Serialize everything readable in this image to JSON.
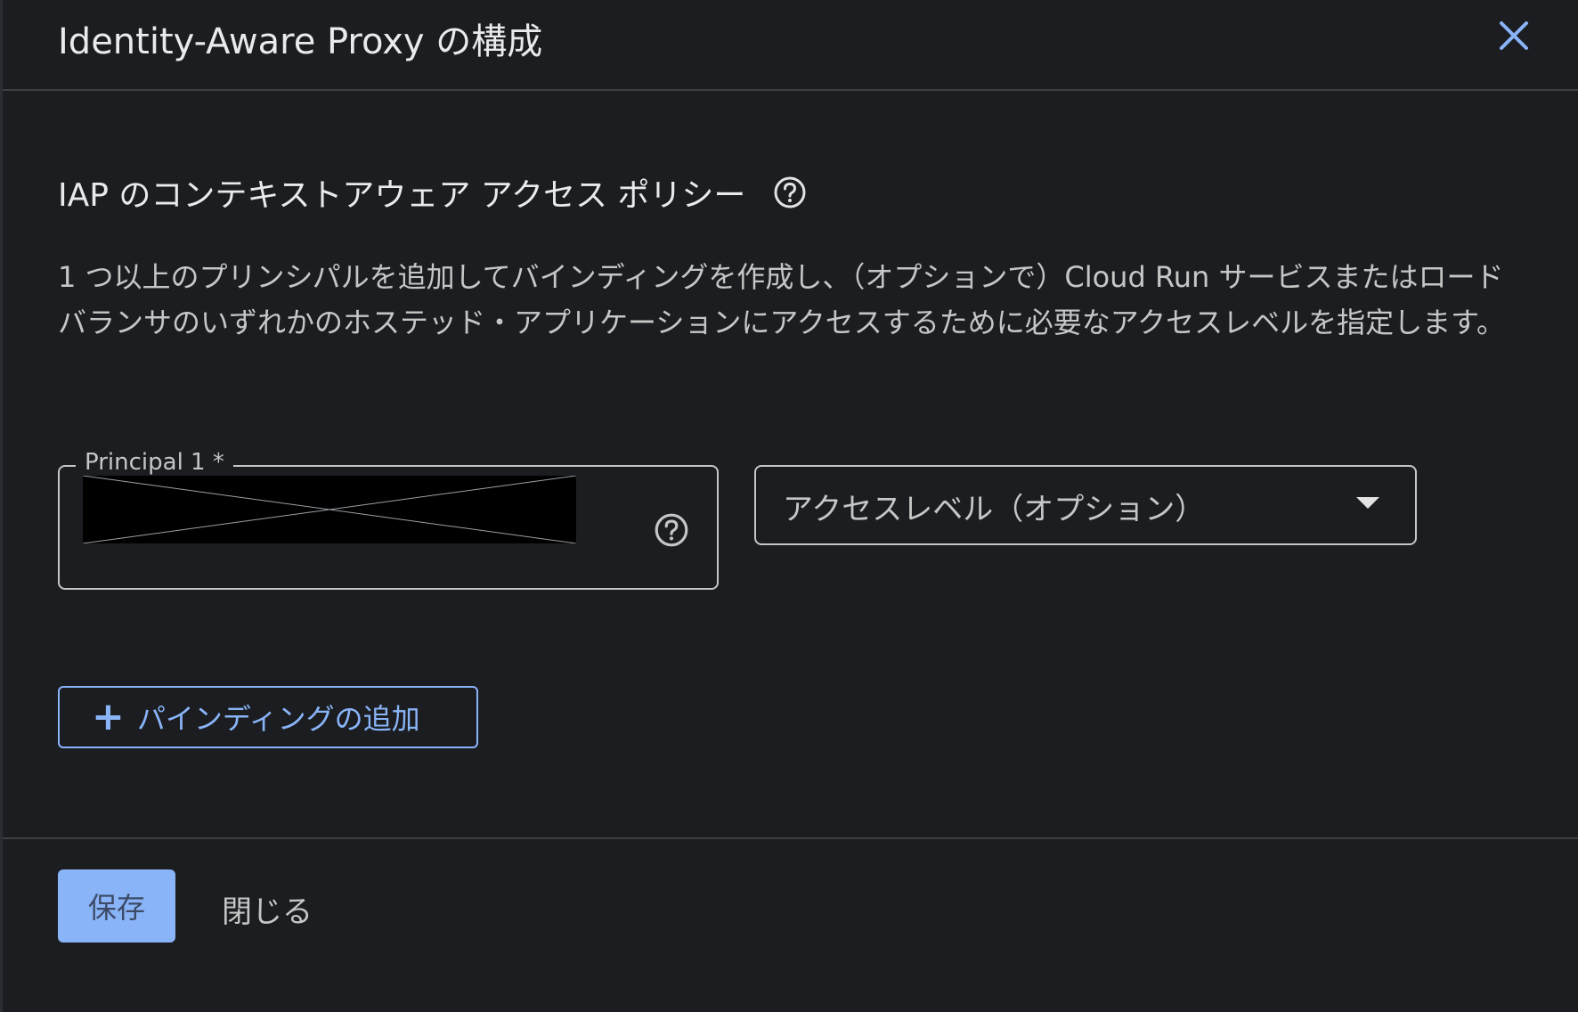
{
  "header": {
    "title": "Identity-Aware Proxy の構成",
    "close_icon": "close-icon"
  },
  "section": {
    "title": "IAP のコンテキストアウェア アクセス ポリシー",
    "help_icon": "help-icon",
    "description": "1 つ以上のプリンシパルを追加してバインディングを作成し、（オプションで）Cloud Run サービスまたはロードバランサのいずれかのホステッド・アプリケーションにアクセスするために必要なアクセスレベルを指定します。"
  },
  "binding": {
    "principal_label": "Principal 1 *",
    "principal_value_redacted": true,
    "access_level_placeholder": "アクセスレベル（オプション）"
  },
  "add_binding_label": "パインディングの追加",
  "footer": {
    "save_label": "保存",
    "close_label": "閉じる"
  },
  "colors": {
    "background": "#1b1d20",
    "accent": "#8ab4f8",
    "text": "#e8eaed",
    "border": "#c4c7c5"
  }
}
